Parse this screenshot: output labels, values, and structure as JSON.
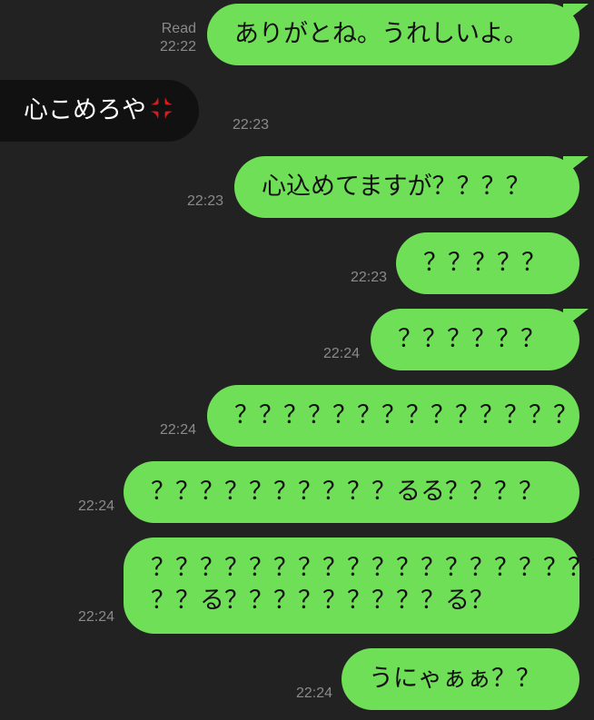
{
  "messages": [
    {
      "dir": "out",
      "text": "ありがとね。うれしいよ。",
      "read": "Read",
      "time": "22:22"
    },
    {
      "dir": "in",
      "text": "心こめろや",
      "emoji": "anger-icon",
      "time": "22:23"
    },
    {
      "dir": "out",
      "text": "心込めてますが？？？？",
      "time": "22:23"
    },
    {
      "dir": "out",
      "text": "？？？？？",
      "time": "22:23"
    },
    {
      "dir": "out",
      "text": "？？？？？？",
      "time": "22:24"
    },
    {
      "dir": "out",
      "text": "？？？？？？？？？？？？？？",
      "time": "22:24"
    },
    {
      "dir": "out",
      "text": "？？？？？？？？？？るる？？？？",
      "time": "22:24"
    },
    {
      "dir": "out",
      "line1": "？？？？？？？？？？？？？？？？？？？",
      "line2": "？？る？？？？？？？？？る？",
      "time": "22:24"
    },
    {
      "dir": "out",
      "text": "うにゃぁぁ？？",
      "time": "22:24"
    }
  ],
  "colors": {
    "background": "#222222",
    "outgoing_bubble": "#6fdf57",
    "incoming_bubble": "#111111",
    "timestamp": "#8a8a8a",
    "anger": "#d61d1d"
  }
}
